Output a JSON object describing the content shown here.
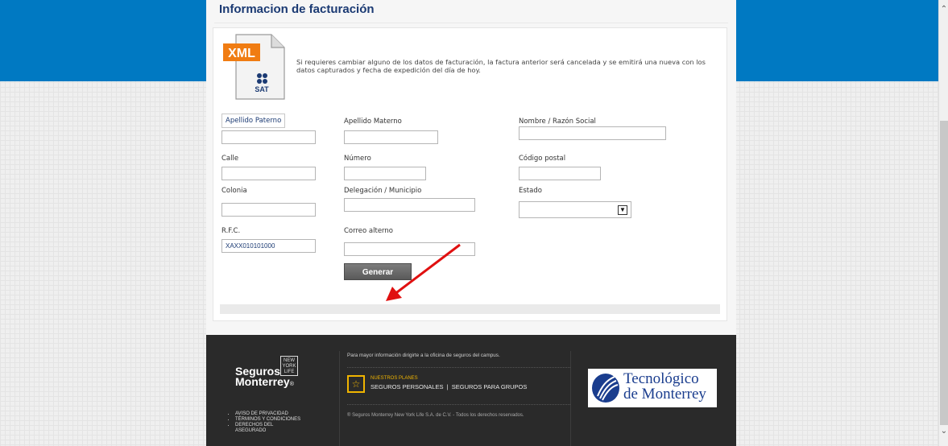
{
  "page": {
    "title": "Informacion de facturación",
    "intro_text": "Si requieres cambiar alguno de los datos de facturación, la factura anterior será cancelada y se emitirá una nueva con los datos capturados y fecha de expedición del día de hoy.",
    "xml_badge": "XML",
    "sat_badge": "SAT"
  },
  "form": {
    "apellido_paterno": {
      "label": "Apellido Paterno",
      "value": ""
    },
    "apellido_materno": {
      "label": "Apellido Materno",
      "value": ""
    },
    "nombre": {
      "label": "Nombre / Razón Social",
      "value": ""
    },
    "calle": {
      "label": "Calle",
      "value": ""
    },
    "numero": {
      "label": "Número",
      "value": ""
    },
    "codigo_postal": {
      "label": "Código postal",
      "value": ""
    },
    "colonia": {
      "label": "Colonia",
      "value": ""
    },
    "delegacion": {
      "label": "Delegación / Municipio",
      "value": ""
    },
    "estado": {
      "label": "Estado",
      "value": ""
    },
    "rfc": {
      "label": "R.F.C.",
      "value": "XAXX010101000"
    },
    "correo": {
      "label": "Correo alterno",
      "value": ""
    },
    "submit_label": "Generar"
  },
  "footer": {
    "brand_line1": "Seguros",
    "brand_line2": "Monterrey",
    "brand_mark": "®",
    "nyl_line1": "NEW",
    "nyl_line2": "YORK",
    "nyl_line3": "LIFE",
    "info_text": "Para mayor información dirigirte a la oficina de seguros del campus.",
    "planes_title": "NUESTROS PLANES",
    "link_personales": "SEGUROS PERSONALES",
    "link_separator": "|",
    "link_grupos": "SEGUROS PARA GRUPOS",
    "copyright": "® Seguros Monterrey New York Life S.A. de C.V. - Todos los derechos reservados.",
    "legal_links": [
      "AVISO DE PRIVACIDAD",
      "TÉRMINOS Y CONDICIONES",
      "DERECHOS DEL",
      "ASEGURADO"
    ],
    "tec_line1": "Tecnológico",
    "tec_line2": "de Monterrey"
  },
  "colors": {
    "brand_blue": "#0079c2",
    "title_navy": "#1b3a73",
    "annotation_arrow": "#e01010",
    "planes_yellow": "#f0b400"
  }
}
